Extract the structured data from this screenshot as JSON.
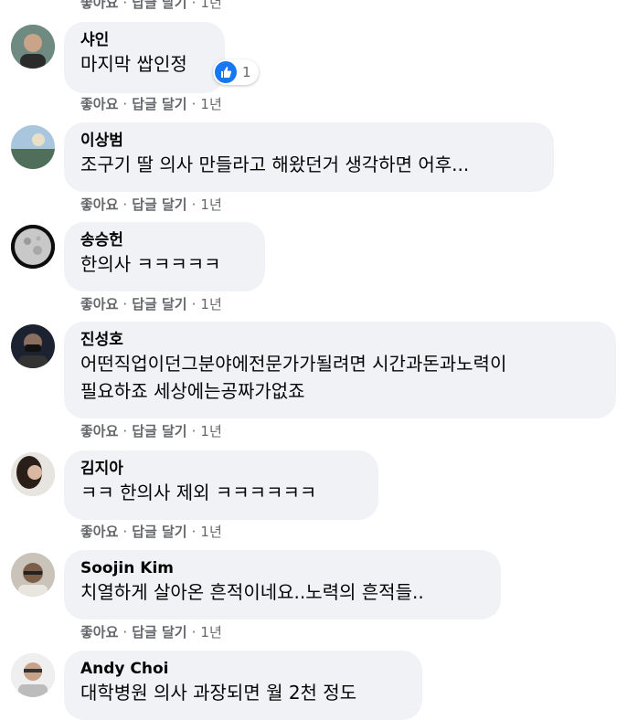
{
  "top_actions": {
    "like": "좋아요",
    "reply": "답글 달기",
    "time": "1년"
  },
  "comments": [
    {
      "name": "샤인",
      "text": [
        "마지막 쌉인정"
      ],
      "reaction_count": "1",
      "actions": {
        "like": "좋아요",
        "reply": "답글 달기",
        "time": "1년"
      }
    },
    {
      "name": "이상범",
      "text": [
        "조구기 딸 의사 만들라고 해왔던거 생각하면 어후..."
      ],
      "actions": {
        "like": "좋아요",
        "reply": "답글 달기",
        "time": "1년"
      }
    },
    {
      "name": "송승헌",
      "text": [
        "한의사 ㅋㅋㅋㅋㅋ"
      ],
      "actions": {
        "like": "좋아요",
        "reply": "답글 달기",
        "time": "1년"
      }
    },
    {
      "name": "진성호",
      "text": [
        "어떤직업이던그분야에전문가가될려면 시간과돈과노력이",
        "필요하죠 세상에는공짜가없죠"
      ],
      "actions": {
        "like": "좋아요",
        "reply": "답글 달기",
        "time": "1년"
      }
    },
    {
      "name": "김지아",
      "text": [
        "ㅋㅋ 한의사 제외 ㅋㅋㅋㅋㅋㅋ"
      ],
      "actions": {
        "like": "좋아요",
        "reply": "답글 달기",
        "time": "1년"
      }
    },
    {
      "name": "Soojin Kim",
      "text": [
        "치열하게 살아온 흔적이네요..노력의 흔적들.."
      ],
      "actions": {
        "like": "좋아요",
        "reply": "답글 달기",
        "time": "1년"
      }
    },
    {
      "name": "Andy Choi",
      "text": [
        "대학병원 의사 과장되면 월 2천 정도"
      ]
    }
  ]
}
